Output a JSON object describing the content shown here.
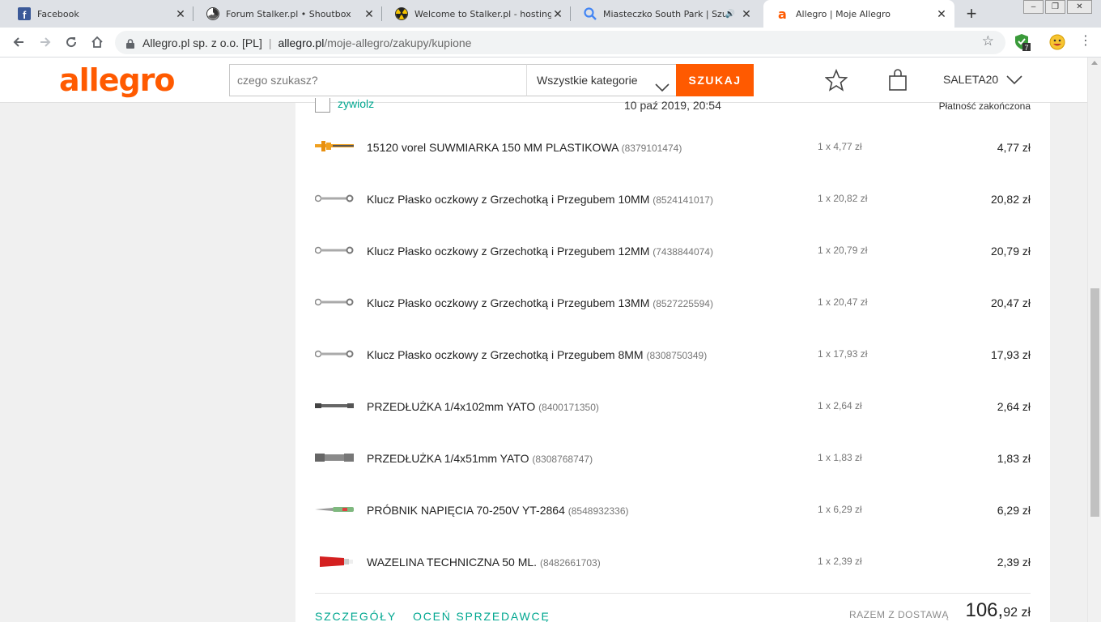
{
  "browser": {
    "tabs": [
      {
        "title": "Facebook",
        "icon": "facebook-icon"
      },
      {
        "title": "Forum Stalker.pl • Shoutbox",
        "icon": "radiation-icon"
      },
      {
        "title": "Welcome to Stalker.pl - hosting zdj",
        "icon": "radiation-yellow-icon"
      },
      {
        "title": "Miasteczko South Park | Szuka",
        "icon": "search-icon"
      },
      {
        "title": "Allegro | Moje Allegro",
        "icon": "allegro-icon"
      }
    ],
    "new_tab": "+",
    "address": {
      "org": "Allegro.pl sp. z o.o. [PL]",
      "domain": "allegro.pl",
      "path": "/moje-allegro/zakupy/kupione"
    },
    "ext_badge": "7"
  },
  "header": {
    "logo": "allegro",
    "search_placeholder": "czego szukasz?",
    "category": "Wszystkie kategorie",
    "search_button": "SZUKAJ",
    "user": "SALETA20"
  },
  "order": {
    "seller": "zywiolz",
    "date": "10 paź 2019, 20:54",
    "status": "Płatność zakończona",
    "items": [
      {
        "name": "15120 vorel SUWMIARKA 150 MM PLASTIKOWA",
        "id": "(8379101474)",
        "qty": "1 x 4,77 zł",
        "price": "4,77 zł",
        "thumb": "caliper"
      },
      {
        "name": "Klucz Płasko oczkowy z Grzechotką i Przegubem 10MM",
        "id": "(8524141017)",
        "qty": "1 x 20,82 zł",
        "price": "20,82 zł",
        "thumb": "wrench"
      },
      {
        "name": "Klucz Płasko oczkowy z Grzechotką i Przegubem 12MM",
        "id": "(7438844074)",
        "qty": "1 x 20,79 zł",
        "price": "20,79 zł",
        "thumb": "wrench"
      },
      {
        "name": "Klucz Płasko oczkowy z Grzechotką i Przegubem 13MM",
        "id": "(8527225594)",
        "qty": "1 x 20,47 zł",
        "price": "20,47 zł",
        "thumb": "wrench"
      },
      {
        "name": "Klucz Płasko oczkowy z Grzechotką i Przegubem 8MM",
        "id": "(8308750349)",
        "qty": "1 x 17,93 zł",
        "price": "17,93 zł",
        "thumb": "wrench"
      },
      {
        "name": "PRZEDŁUŻKA 1/4x102mm YATO",
        "id": "(8400171350)",
        "qty": "1 x 2,64 zł",
        "price": "2,64 zł",
        "thumb": "extension"
      },
      {
        "name": "PRZEDŁUŻKA 1/4x51mm YATO",
        "id": "(8308768747)",
        "qty": "1 x 1,83 zł",
        "price": "1,83 zł",
        "thumb": "extension-short"
      },
      {
        "name": "PRÓBNIK NAPIĘCIA 70-250V YT-2864",
        "id": "(8548932336)",
        "qty": "1 x 6,29 zł",
        "price": "6,29 zł",
        "thumb": "tester"
      },
      {
        "name": "WAZELINA TECHNICZNA 50 ML.",
        "id": "(8482661703)",
        "qty": "1 x 2,39 zł",
        "price": "2,39 zł",
        "thumb": "tube"
      }
    ],
    "details_link": "SZCZEGÓŁY",
    "rate_link": "OCEŃ SPRZEDAWCĘ",
    "total_label": "RAZEM Z DOSTAWĄ",
    "total_int": "106,",
    "total_dec": "92 zł"
  },
  "colors": {
    "accent": "#ff5a00",
    "link": "#00a790"
  }
}
